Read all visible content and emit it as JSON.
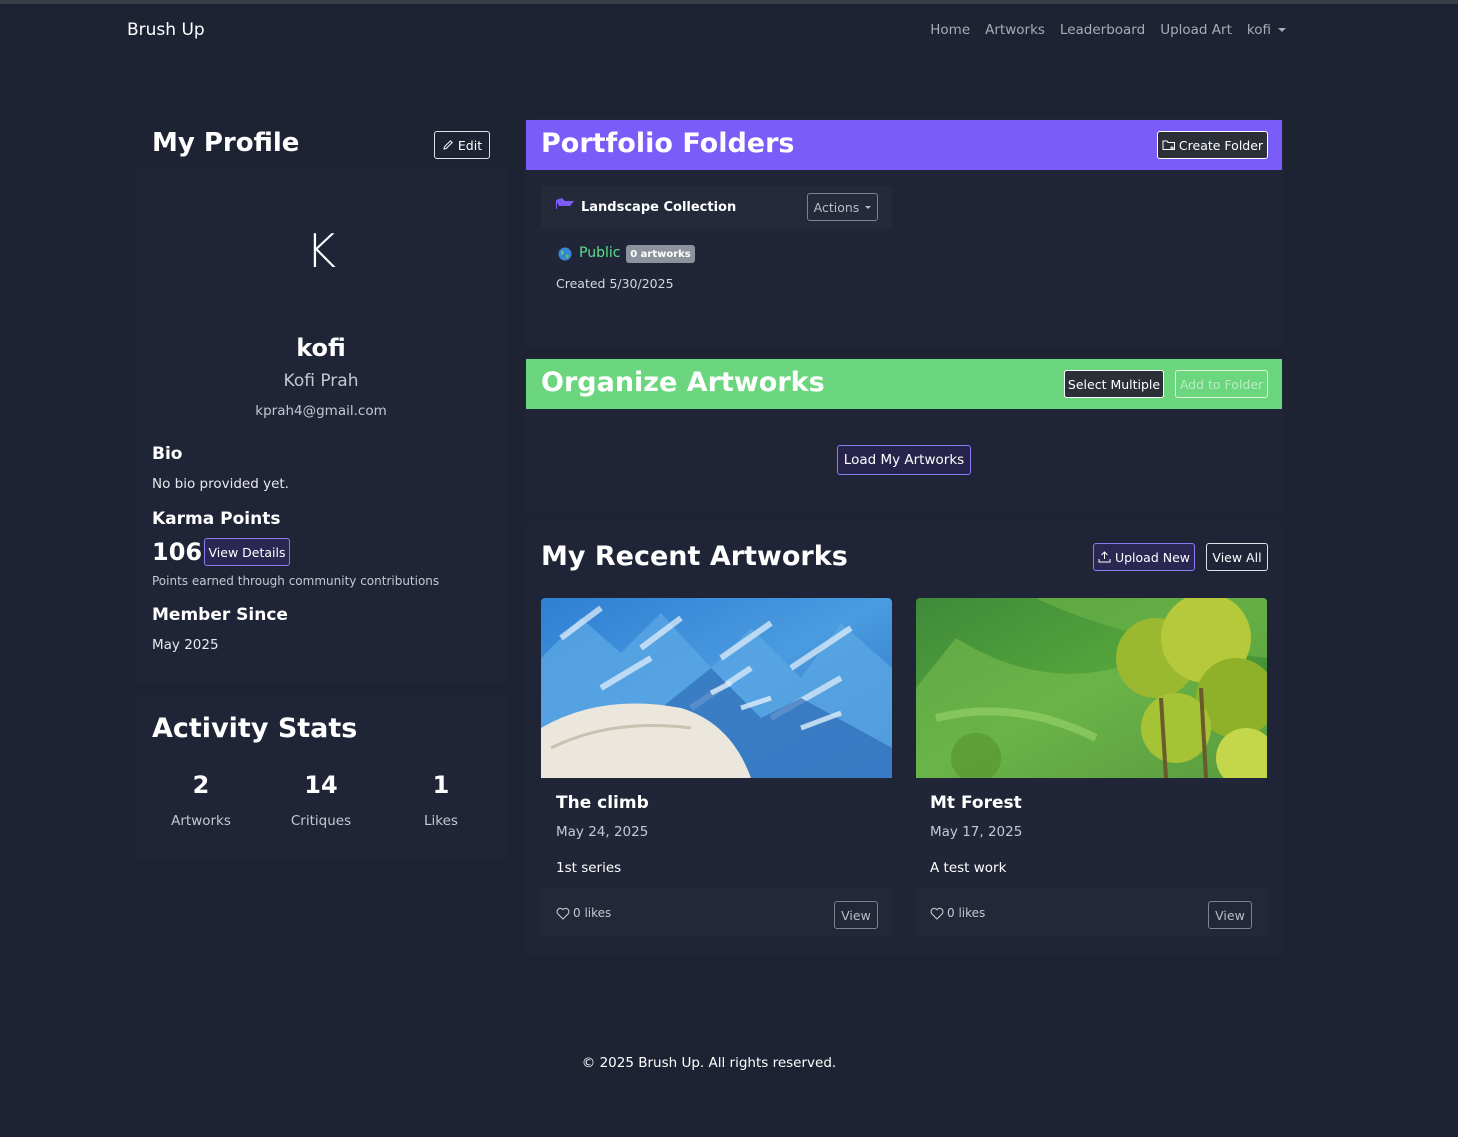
{
  "navbar": {
    "brand": "Brush Up",
    "links": [
      "Home",
      "Artworks",
      "Leaderboard",
      "Upload Art"
    ],
    "user": "kofi"
  },
  "profile": {
    "heading": "My Profile",
    "edit_label": "Edit",
    "avatar_letter": "K",
    "username": "kofi",
    "full_name": "Kofi Prah",
    "email": "kprah4@gmail.com",
    "bio_label": "Bio",
    "bio_text": "No bio provided yet.",
    "karma_label": "Karma Points",
    "karma_value": "106",
    "view_details_label": "View Details",
    "karma_note": "Points earned through community contributions",
    "member_since_label": "Member Since",
    "member_since_value": "May 2025"
  },
  "activity": {
    "heading": "Activity Stats",
    "stats": [
      {
        "value": "2",
        "label": "Artworks"
      },
      {
        "value": "14",
        "label": "Critiques"
      },
      {
        "value": "1",
        "label": "Likes"
      }
    ]
  },
  "portfolio": {
    "heading": "Portfolio Folders",
    "create_label": "Create Folder",
    "accent": "#7a5cf8",
    "folder": {
      "name": "Landscape Collection",
      "actions_label": "Actions",
      "visibility": "Public",
      "count_badge": "0 artworks",
      "created": "Created 5/30/2025"
    }
  },
  "organize": {
    "heading": "Organize Artworks",
    "accent": "#6cd67f",
    "select_multiple_label": "Select Multiple",
    "add_to_folder_label": "Add to Folder",
    "load_label": "Load My Artworks"
  },
  "recent": {
    "heading": "My Recent Artworks",
    "upload_label": "Upload New",
    "view_all_label": "View All",
    "artworks": [
      {
        "title": "The climb",
        "date": "May 24, 2025",
        "description": "1st series",
        "likes": "0 likes",
        "view_label": "View"
      },
      {
        "title": "Mt Forest",
        "date": "May 17, 2025",
        "description": "A test work",
        "likes": "0 likes",
        "view_label": "View"
      }
    ]
  },
  "footer": {
    "text": "© 2025 Brush Up. All rights reserved."
  }
}
